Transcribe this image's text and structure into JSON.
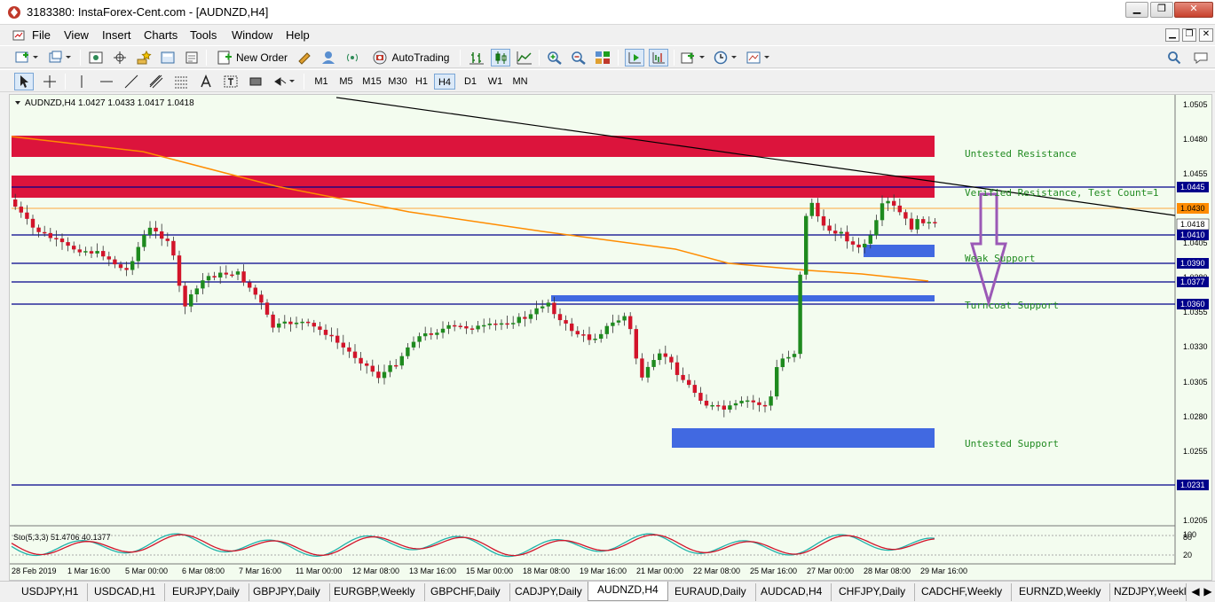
{
  "window": {
    "title": "3183380: InstaForex-Cent.com - [AUDNZD,H4]",
    "controls": [
      "▁",
      "❐",
      "✕"
    ],
    "mdi_controls": [
      "▁",
      "❐",
      "✕"
    ]
  },
  "menu": [
    "File",
    "View",
    "Insert",
    "Charts",
    "Tools",
    "Window",
    "Help"
  ],
  "toolbar": {
    "new_order_label": "New Order",
    "autotrading_label": "AutoTrading"
  },
  "timeframes": [
    "M1",
    "M5",
    "M15",
    "M30",
    "H1",
    "H4",
    "D1",
    "W1",
    "MN"
  ],
  "active_timeframe": "H4",
  "chart": {
    "header": "AUDNZD,H4  1.0427 1.0433 1.0417 1.0418",
    "indicator_label": "Sto(5,3,3) 51.4706 40.1377",
    "price_axis": [
      "1.0505",
      "1.0480",
      "1.0455",
      "1.0405",
      "1.0380",
      "1.0355",
      "1.0330",
      "1.0305",
      "1.0280",
      "1.0255",
      "1.0205"
    ],
    "price_tags": [
      {
        "label": "1.0445",
        "kind": "level"
      },
      {
        "label": "1.0430",
        "kind": "orange"
      },
      {
        "label": "1.0418",
        "kind": "bid"
      },
      {
        "label": "1.0410",
        "kind": "level"
      },
      {
        "label": "1.0390",
        "kind": "level"
      },
      {
        "label": "1.0377",
        "kind": "level"
      },
      {
        "label": "1.0360",
        "kind": "level"
      },
      {
        "label": "1.0231",
        "kind": "level"
      }
    ],
    "indicator_axis": [
      "100",
      "80",
      "20"
    ],
    "time_axis": [
      "28 Feb 2019",
      "1 Mar 16:00",
      "5 Mar 00:00",
      "6 Mar 08:00",
      "7 Mar 16:00",
      "11 Mar 00:00",
      "12 Mar 08:00",
      "13 Mar 16:00",
      "15 Mar 00:00",
      "18 Mar 08:00",
      "19 Mar 16:00",
      "21 Mar 00:00",
      "22 Mar 08:00",
      "25 Mar 16:00",
      "27 Mar 00:00",
      "28 Mar 08:00",
      "29 Mar 16:00"
    ],
    "annotations": {
      "untested_resistance": "Untested Resistance",
      "verified_resistance": "Verified Resistance, Test Count=1",
      "weak_support": "Weak Support",
      "turncoat_support": "Turncoat Support",
      "untested_support": "Untested Support"
    },
    "colors": {
      "bull": "#1e8a1e",
      "bear": "#d2142a",
      "resistance_zone": "#dc143c",
      "support_zone": "#4169e1",
      "level_line": "#00008b",
      "moving_average": "#ff8c00",
      "trendline": "#000000",
      "arrow": "#9b59b6",
      "sto_main": "#20b2aa",
      "sto_signal": "#d2142a"
    }
  },
  "symbol_tabs": [
    "USDJPY,H1",
    "USDCAD,H1",
    "EURJPY,Daily",
    "GBPJPY,Daily",
    "EURGBP,Weekly",
    "GBPCHF,Daily",
    "CADJPY,Daily",
    "AUDNZD,H4",
    "EURAUD,Daily",
    "AUDCAD,H4",
    "CHFJPY,Daily",
    "CADCHF,Weekly",
    "EURNZD,Weekly",
    "NZDJPY,Weekl"
  ],
  "active_symbol_tab": "AUDNZD,H4"
}
